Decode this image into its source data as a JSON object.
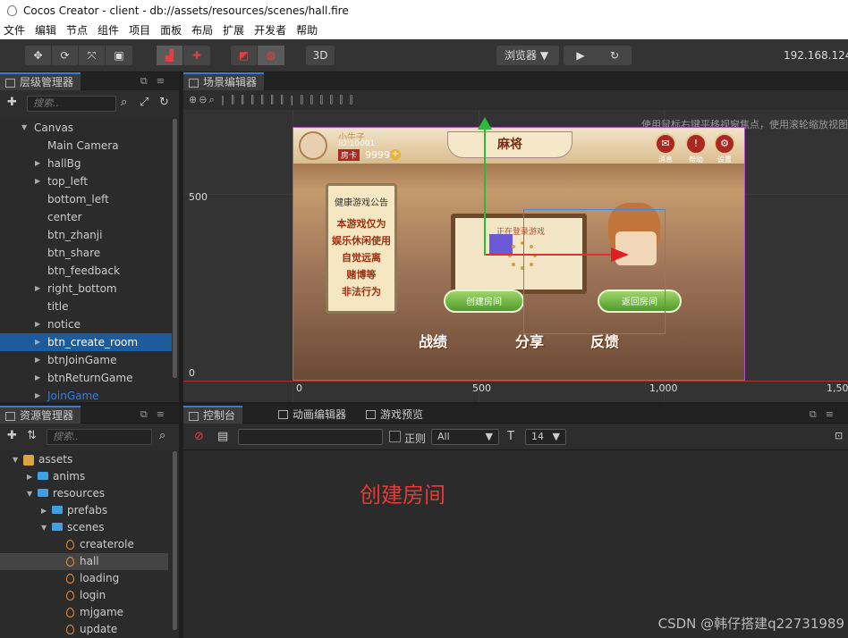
{
  "window": {
    "title": "Cocos Creator - client - db://assets/resources/scenes/hall.fire"
  },
  "menu": [
    "文件",
    "编辑",
    "节点",
    "组件",
    "项目",
    "面板",
    "布局",
    "扩展",
    "开发者",
    "帮助"
  ],
  "toolbar": {
    "btn3d": "3D",
    "browser": "浏览器 ▼",
    "play": "▶",
    "refresh": "↻",
    "ip": "192.168.124."
  },
  "hierarchy": {
    "title": "层级管理器",
    "search_placeholder": "搜索..",
    "items": [
      {
        "label": "Canvas",
        "level": 1,
        "expanded": true
      },
      {
        "label": "Main Camera",
        "level": 2
      },
      {
        "label": "hallBg",
        "level": 2,
        "collapsed": true
      },
      {
        "label": "top_left",
        "level": 2,
        "collapsed": true
      },
      {
        "label": "bottom_left",
        "level": 2
      },
      {
        "label": "center",
        "level": 2
      },
      {
        "label": "btn_zhanji",
        "level": 2
      },
      {
        "label": "btn_share",
        "level": 2
      },
      {
        "label": "btn_feedback",
        "level": 2
      },
      {
        "label": "right_bottom",
        "level": 2,
        "collapsed": true
      },
      {
        "label": "title",
        "level": 2
      },
      {
        "label": "notice",
        "level": 2,
        "collapsed": true
      },
      {
        "label": "btn_create_room",
        "level": 2,
        "collapsed": true,
        "selected": true
      },
      {
        "label": "btnJoinGame",
        "level": 2,
        "collapsed": true
      },
      {
        "label": "btnReturnGame",
        "level": 2,
        "collapsed": true
      },
      {
        "label": "JoinGame",
        "level": 2,
        "collapsed": true,
        "dim": true
      }
    ]
  },
  "scene": {
    "title": "场景编辑器",
    "hint": "使用鼠标右键平移视窗焦点，使用滚轮缩放视图",
    "y500": "500",
    "y0": "0",
    "x0": "0",
    "x500": "500",
    "x1000": "1,000",
    "x1500": "1,50"
  },
  "game": {
    "title": "麻将",
    "player_name": "小牛子",
    "player_id": "ID:10001",
    "card_label": "房卡",
    "card_count": "9999",
    "plus": "+",
    "icons": [
      {
        "label": "消息"
      },
      {
        "label": "帮助"
      },
      {
        "label": "设置"
      }
    ],
    "notice_title": "健康游戏公告",
    "notice_lines": [
      "本游戏仅为",
      "娱乐休闲使用",
      "自觉远离",
      "赌博等",
      "非法行为"
    ],
    "board_text": "正在登录游戏",
    "create_btn": "创建房间",
    "return_btn": "返回房间",
    "bottom_buttons": [
      "战绩",
      "分享",
      "反馈"
    ]
  },
  "assets": {
    "title": "资源管理器",
    "search_placeholder": "搜索..",
    "items": [
      {
        "label": "assets",
        "level": 1,
        "kind": "root"
      },
      {
        "label": "anims",
        "level": 2,
        "kind": "folder"
      },
      {
        "label": "resources",
        "level": 2,
        "kind": "folder",
        "expanded": true
      },
      {
        "label": "prefabs",
        "level": 3,
        "kind": "folder"
      },
      {
        "label": "scenes",
        "level": 3,
        "kind": "folder",
        "expanded": true
      },
      {
        "label": "createrole",
        "level": 4,
        "kind": "fire"
      },
      {
        "label": "hall",
        "level": 4,
        "kind": "fire",
        "hover": true
      },
      {
        "label": "loading",
        "level": 4,
        "kind": "fire"
      },
      {
        "label": "login",
        "level": 4,
        "kind": "fire"
      },
      {
        "label": "mjgame",
        "level": 4,
        "kind": "fire"
      },
      {
        "label": "update",
        "level": 4,
        "kind": "fire"
      }
    ]
  },
  "bottom_tabs": [
    {
      "label": "控制台"
    },
    {
      "label": "动画编辑器"
    },
    {
      "label": "游戏预览"
    }
  ],
  "console": {
    "regex_label": "正则",
    "level": "All",
    "font_size": "14"
  },
  "overlay_text": "创建房间",
  "watermark": "CSDN @韩仔搭建q22731989"
}
